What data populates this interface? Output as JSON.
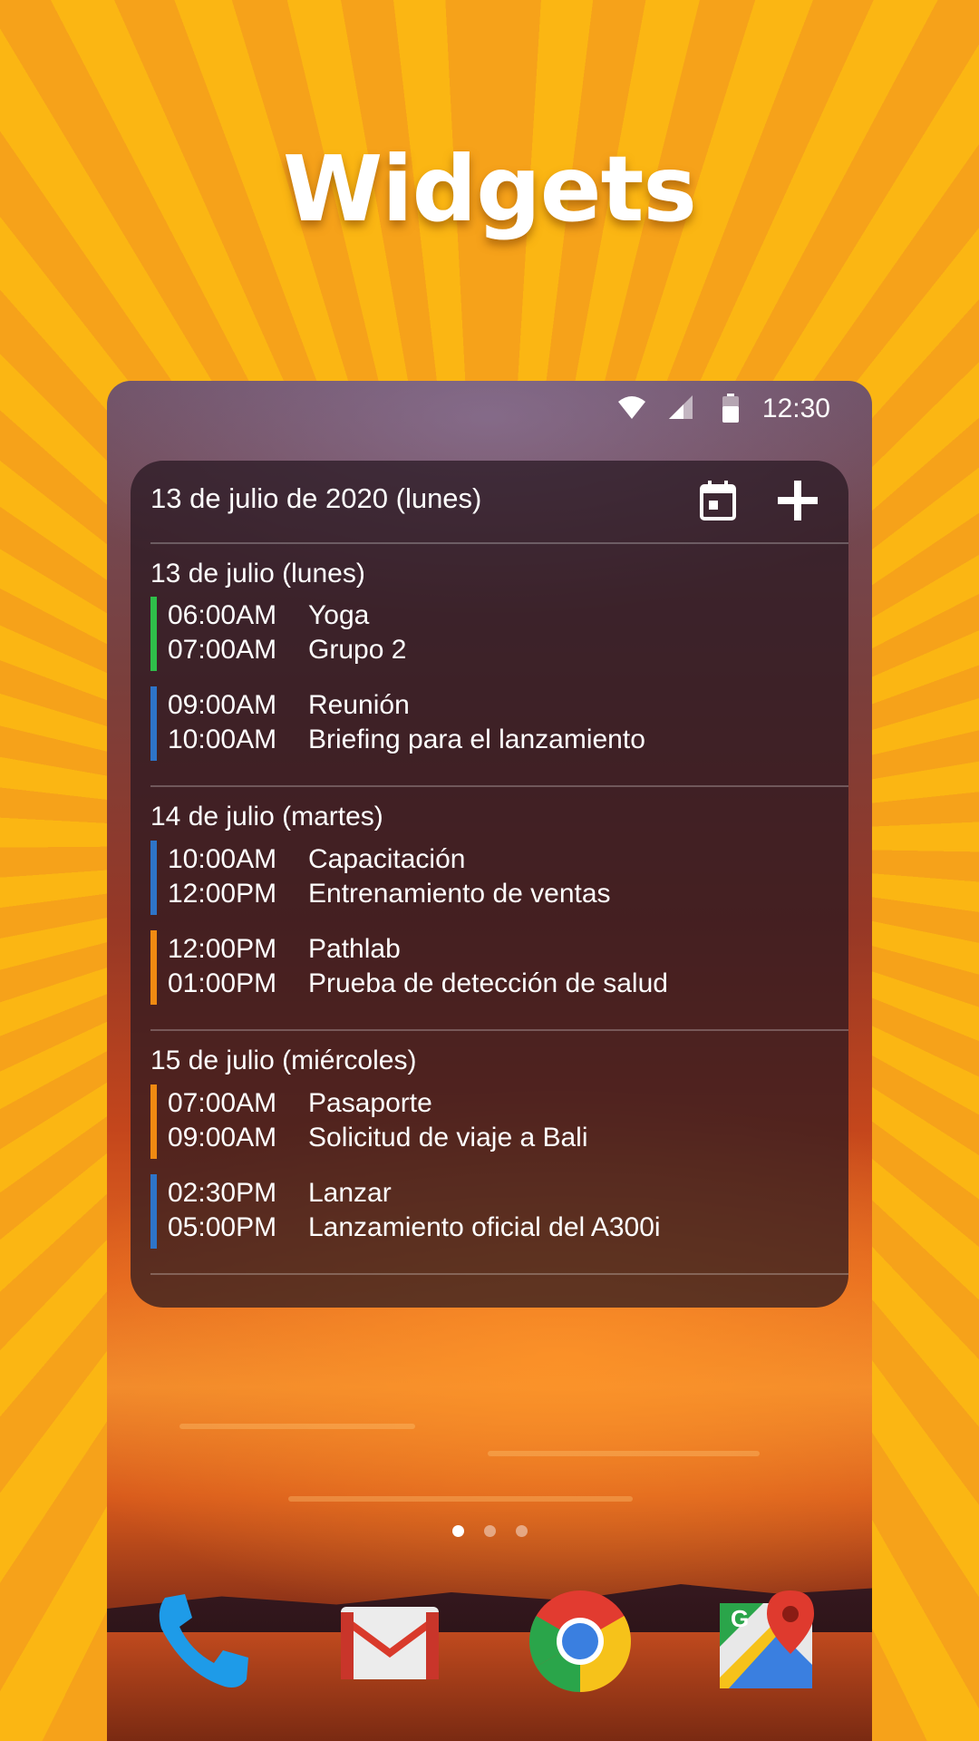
{
  "promo": {
    "title": "Widgets"
  },
  "status_bar": {
    "time": "12:30",
    "icons": [
      "wifi-icon",
      "signal-icon",
      "battery-icon"
    ]
  },
  "widget": {
    "date_header": "13 de julio de 2020 (lunes)",
    "buttons": [
      "calendar-icon",
      "add-icon"
    ],
    "days": [
      {
        "label": "13 de julio (lunes)",
        "events": [
          {
            "start": "06:00AM",
            "title": "Yoga",
            "end": "07:00AM",
            "detail": "Grupo 2",
            "color": "#2fbf4a"
          },
          {
            "start": "09:00AM",
            "title": "Reunión",
            "end": "10:00AM",
            "detail": "Briefing para el lanzamiento",
            "color": "#2e74c8"
          }
        ]
      },
      {
        "label": "14 de julio (martes)",
        "events": [
          {
            "start": "10:00AM",
            "title": "Capacitación",
            "end": "12:00PM",
            "detail": "Entrenamiento de ventas",
            "color": "#2e74c8"
          },
          {
            "start": "12:00PM",
            "title": "Pathlab",
            "end": "01:00PM",
            "detail": "Prueba de detección de salud",
            "color": "#f08a12"
          }
        ]
      },
      {
        "label": "15 de julio (miércoles)",
        "events": [
          {
            "start": "07:00AM",
            "title": "Pasaporte",
            "end": "09:00AM",
            "detail": "Solicitud de viaje a Bali",
            "color": "#f08a12"
          },
          {
            "start": "02:30PM",
            "title": "Lanzar",
            "end": "05:00PM",
            "detail": "Lanzamiento oficial del A300i",
            "color": "#2e74c8"
          }
        ]
      }
    ]
  },
  "home": {
    "page_count": 3,
    "active_page": 1,
    "dock": [
      "phone-icon",
      "gmail-icon",
      "chrome-icon",
      "maps-icon"
    ]
  }
}
